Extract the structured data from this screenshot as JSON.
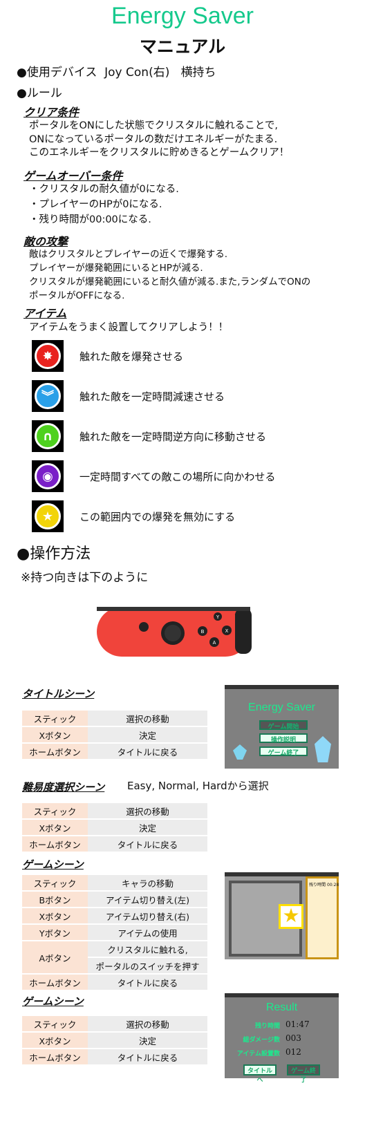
{
  "header": {
    "title": "Energy Saver",
    "subtitle": "マニュアル"
  },
  "device": {
    "label": "●使用デバイス",
    "value": "Joy Con(右)",
    "orientation": "横持ち"
  },
  "rules": {
    "label": "●ルール",
    "clear": {
      "heading": "クリア条件",
      "lines": [
        "ポータルをONにした状態でクリスタルに触れることで,",
        "ONになっているポータルの数だけエネルギーがたまる.",
        "このエネルギーをクリスタルに貯めきるとゲームクリア！"
      ]
    },
    "gameover": {
      "heading": "ゲームオーバー条件",
      "lines": [
        "・クリスタルの耐久値が0になる.",
        "・プレイヤーのHPが0になる.",
        "・残り時間が00:00になる."
      ]
    },
    "enemy": {
      "heading": "敵の攻撃",
      "lines": [
        "敵はクリスタルとプレイヤーの近くで爆発する.",
        "プレイヤーが爆発範囲にいるとHPが減る.",
        "クリスタルが爆発範囲にいると耐久値が減る.また,ランダムでONの",
        "ポータルがOFFになる."
      ]
    },
    "items": {
      "heading": "アイテム",
      "intro": "アイテムをうまく設置してクリアしよう！！",
      "list": [
        {
          "icon": "explosion-icon",
          "color": "#e8231f",
          "glyph": "✸",
          "text": "触れた敵を爆発させる"
        },
        {
          "icon": "slow-down-icon",
          "color": "#2aa0e8",
          "glyph": "︾",
          "text": "触れた敵を一定時間減速させる"
        },
        {
          "icon": "u-turn-icon",
          "color": "#4ed11e",
          "glyph": "∩",
          "text": "触れた敵を一定時間逆方向に移動させる"
        },
        {
          "icon": "vortex-icon",
          "color": "#7a1fc8",
          "glyph": "◉",
          "text": "一定時間すべての敵この場所に向かわせる"
        },
        {
          "icon": "star-shield-icon",
          "color": "#f2d40a",
          "glyph": "★",
          "text": "この範囲内での爆発を無効にする"
        }
      ]
    }
  },
  "controls": {
    "label": "●操作方法",
    "note": "※持つ向きは下のように",
    "joycon_buttons": [
      "X",
      "Y",
      "A",
      "B",
      "+"
    ],
    "scenes": [
      {
        "heading": "タイトルシーン",
        "rows": [
          [
            "スティック",
            "選択の移動"
          ],
          [
            "Xボタン",
            "決定"
          ],
          [
            "ホームボタン",
            "タイトルに戻る"
          ]
        ]
      },
      {
        "heading": "難易度選択シーン",
        "note": "Easy, Normal, Hardから選択",
        "rows": [
          [
            "スティック",
            "選択の移動"
          ],
          [
            "Xボタン",
            "決定"
          ],
          [
            "ホームボタン",
            "タイトルに戻る"
          ]
        ]
      },
      {
        "heading": "ゲームシーン",
        "rows": [
          [
            "スティック",
            "キャラの移動"
          ],
          [
            "Bボタン",
            "アイテム切り替え(左)"
          ],
          [
            "Xボタン",
            "アイテム切り替え(右)"
          ],
          [
            "Yボタン",
            "アイテムの使用"
          ],
          [
            "Aボタン",
            "クリスタルに触れる,",
            "ポータルのスイッチを押す"
          ],
          [
            "ホームボタン",
            "タイトルに戻る"
          ]
        ]
      },
      {
        "heading": "ゲームシーン",
        "rows": [
          [
            "スティック",
            "選択の移動"
          ],
          [
            "Xボタン",
            "決定"
          ],
          [
            "ホームボタン",
            "タイトルに戻る"
          ]
        ]
      }
    ]
  },
  "screens": {
    "title": {
      "name": "Energy Saver",
      "buttons": [
        "ゲーム開始",
        "操作説明",
        "ゲーム終了"
      ]
    },
    "game": {
      "time_label": "残り時間",
      "time": "00:28"
    },
    "result": {
      "title": "Result",
      "rows": [
        [
          "残り時間",
          "01:47"
        ],
        [
          "総ダメージ数",
          "003"
        ],
        [
          "アイテム設置数",
          "012"
        ]
      ],
      "buttons": [
        "タイトルへ",
        "ゲーム終了"
      ]
    }
  }
}
